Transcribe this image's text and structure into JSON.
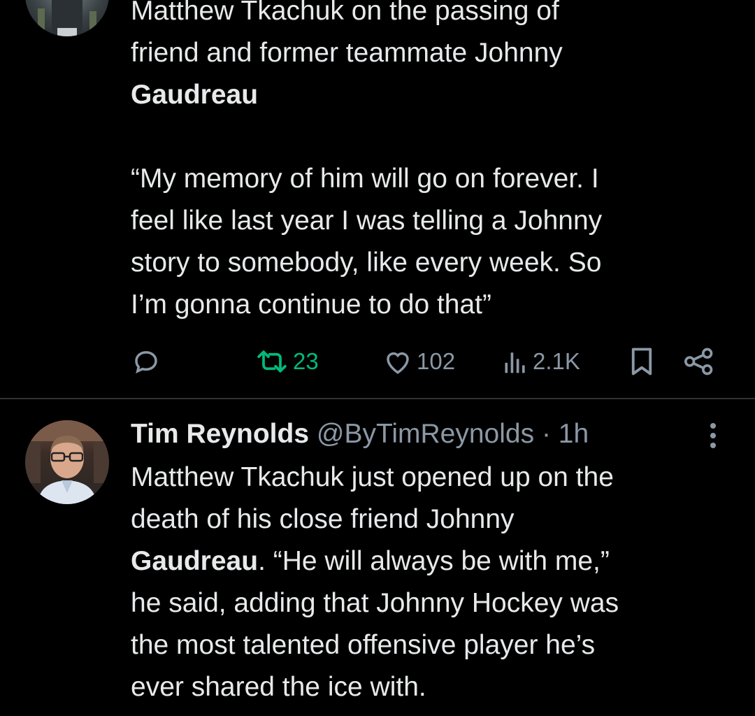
{
  "tweet1": {
    "body_lines": [
      "Matthew Tkachuk on the passing of",
      "friend and former teammate Johnny",
      "Gaudreau"
    ],
    "quote_lines": [
      "“My memory of him will go on forever. I",
      "feel like last year I was telling a Johnny",
      "story to somebody, like every week. So",
      "I’m gonna continue to do that”"
    ],
    "actions": {
      "reply_icon": "reply-icon",
      "retweet_count": "23",
      "like_count": "102",
      "views_count": "2.1K",
      "bookmark_icon": "bookmark-icon",
      "share_icon": "share-icon"
    }
  },
  "tweet2": {
    "author_name": "Tim Reynolds",
    "handle": "@ByTimReynolds",
    "separator": "·",
    "time": "1h",
    "body_lines": [
      "Matthew Tkachuk just opened up on the",
      "death of his close friend Johnny",
      "Gaudreau. “He will always be with me,”",
      "he said, adding that Johnny Hockey was",
      "the most talented offensive player he’s",
      "ever shared the ice with."
    ],
    "bold_word": "Gaudreau",
    "after_bold": ". “He will always be with me,”"
  },
  "colors": {
    "background": "#000000",
    "text": "#e7e9ea",
    "muted": "#8b98a5",
    "retweet_green": "#00ba7c",
    "divider": "#2f3336"
  }
}
